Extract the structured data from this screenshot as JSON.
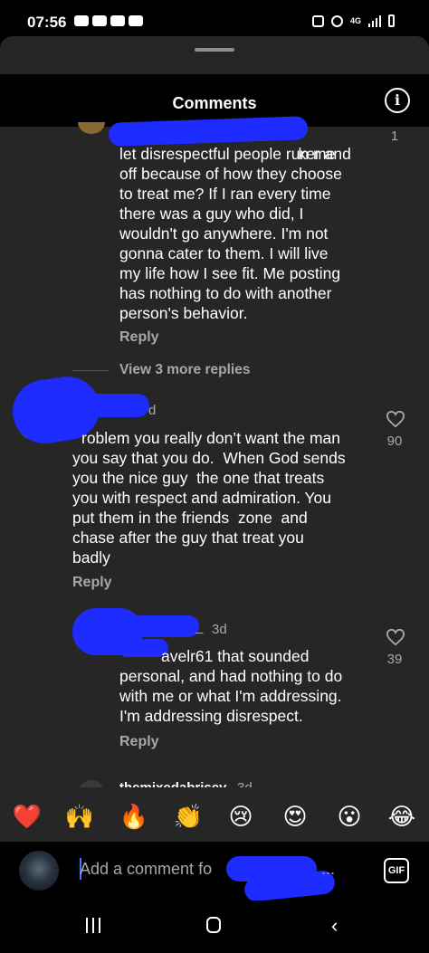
{
  "status_bar": {
    "time": "07:56",
    "network": "4G"
  },
  "header": {
    "title": "Comments",
    "info_glyph": "i"
  },
  "comments": [
    {
      "lines": [
        "ker and",
        "let disrespectful people run me",
        "off because of how they choose",
        "to treat me? If I ran every time",
        "there was a guy who did, I",
        "wouldn't go anywhere. I'm not",
        "gonna cater to them. I will live",
        "my life how I see fit. Me posting",
        "has nothing to do with another",
        "person's behavior."
      ],
      "likes": "1",
      "reply_label": "Reply"
    },
    {
      "time": "d",
      "lines": [
        "roblem you really don’t want the man",
        "you say that you do.  When God sends",
        "you the nice guy  the one that treats",
        "you with respect and admiration. You",
        "put them in the friends  zone  and",
        "chase after the guy that treat you",
        "badly"
      ],
      "likes": "90",
      "reply_label": "Reply"
    },
    {
      "username_tail": "_",
      "time": "3d",
      "lines": [
        "avelr61 that sounded",
        "personal, and had nothing to do",
        "with me or what I'm addressing.",
        "I'm addressing disrespect."
      ],
      "likes": "39",
      "reply_label": "Reply"
    }
  ],
  "view_more": "View 3 more replies",
  "cut_off_comment": {
    "username": "themixedabrisey",
    "time": "3d"
  },
  "emoji_bar": [
    "❤️",
    "🙌",
    "🔥",
    "👏",
    "😢",
    "😍",
    "😮",
    "😂"
  ],
  "input": {
    "placeholder": "Add a comment fo",
    "tail": "...",
    "gif_label": "GIF"
  },
  "icons": {
    "info": "info-icon",
    "heart": "heart-icon",
    "gif": "gif-icon",
    "nav_recent": "recent-apps-icon",
    "nav_home": "home-icon",
    "nav_back": "back-icon"
  },
  "colors": {
    "sheet_bg": "#262626",
    "secondary_text": "#a8a8a8",
    "redaction": "#1f2cff",
    "cursor": "#3b7dff"
  }
}
